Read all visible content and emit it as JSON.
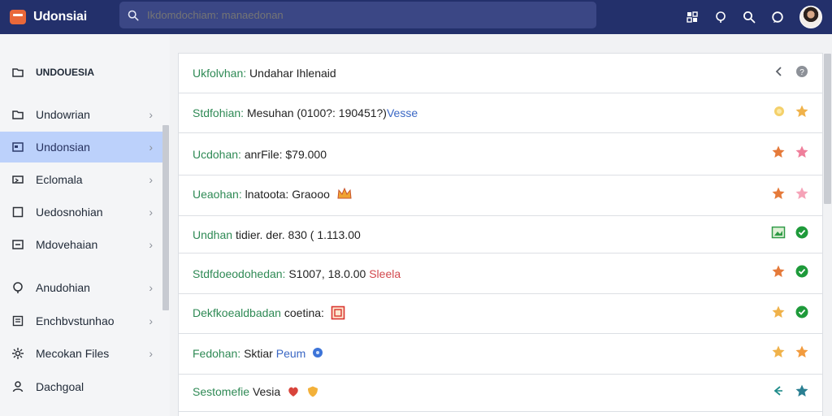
{
  "app": {
    "name": "Udonsiai"
  },
  "search": {
    "placeholder": "Ikdomdochiam: manaedonan"
  },
  "colors": {
    "topbar": "#23306b",
    "accent": "#e9683a",
    "active_item": "#bcd1fb",
    "green_text": "#2f8a55",
    "star_orange": "#e57a3a",
    "star_pink": "#ef7f9b",
    "star_gold": "#f0b24a",
    "check_green": "#1e9a3a"
  },
  "sidebar": {
    "header": {
      "label": "UNDOUESIA",
      "icon": "folder-icon"
    },
    "items": [
      {
        "label": "Undowrian",
        "icon": "folder-icon"
      },
      {
        "label": "Undonsian",
        "icon": "folder-open-icon",
        "active": true
      },
      {
        "label": "Eclomala",
        "icon": "tag-icon"
      },
      {
        "label": "Uedosnohian",
        "icon": "square-icon"
      },
      {
        "label": "Mdovehaian",
        "icon": "archive-icon"
      },
      {
        "label": "Anudohian",
        "icon": "info-icon"
      },
      {
        "label": "Enchbvstunhao",
        "icon": "list-icon"
      },
      {
        "label": "Mecokan Files",
        "icon": "settings-icon"
      },
      {
        "label": "Dachgoal",
        "icon": "person-icon"
      }
    ]
  },
  "rows": [
    {
      "key": "Ukfolvhan:",
      "value": "Undahar Ihlenaid",
      "actions": [
        "back-icon",
        "help-icon"
      ]
    },
    {
      "key": "Stdfohian:",
      "value": "Mesuhan (0100?: 190451?)",
      "value_extra": "Vesse",
      "extra_style": "blue",
      "actions": [
        "coin-icon",
        "star-gold-icon"
      ]
    },
    {
      "key": "Ucdohan:",
      "value": "anrFile: $79.000",
      "actions": [
        "star-orange-icon",
        "star-pink-icon"
      ]
    },
    {
      "key": "Ueaohan:",
      "value": "lnatoota: Graooo",
      "inline_icon": "crown-icon",
      "actions": [
        "star-orange-icon",
        "star-pink-icon"
      ]
    },
    {
      "key": "Undhan",
      "value": "tidier. der. 830 ( 1.113.00",
      "actions": [
        "image-icon",
        "check-icon"
      ]
    },
    {
      "key": "Stdfdoeodohedan:",
      "value": "S1007, 18.0.00",
      "value_extra": "Sleela",
      "extra_style": "red",
      "actions": [
        "star-orange-icon",
        "check-icon"
      ]
    },
    {
      "key": "Dekfkoealdbadan",
      "value": "coetina:",
      "inline_icon": "calendar-icon",
      "actions": [
        "star-gold-icon",
        "check-icon"
      ]
    },
    {
      "key": "Fedohan:",
      "value": "Sktiar",
      "value_extra": "Peum",
      "extra_style": "blue",
      "inline_icon": "info-dot-icon",
      "actions": [
        "star-gold-icon",
        "star-orange-icon"
      ]
    },
    {
      "key": "Sestomefie",
      "value": "Vesia",
      "inline_icon": "heart-icon",
      "inline_icon2": "shield-icon",
      "actions": [
        "reply-icon",
        "star-teal-icon"
      ]
    }
  ]
}
